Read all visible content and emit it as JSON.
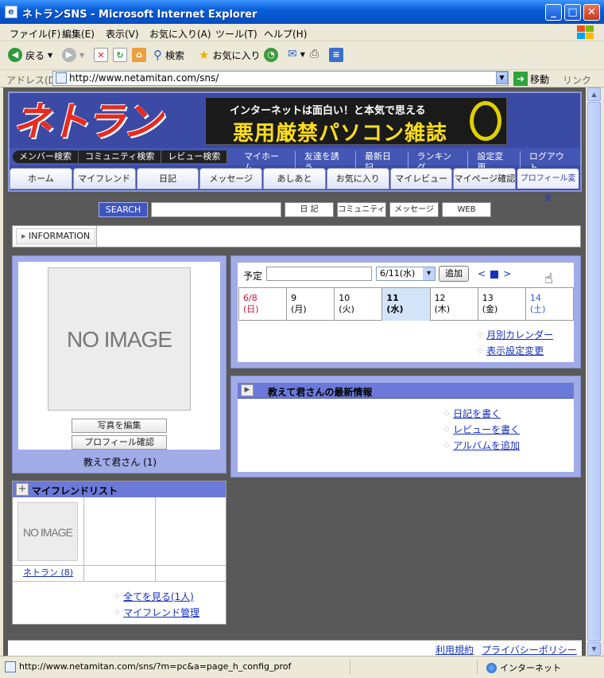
{
  "window": {
    "title": "ネトランSNS - Microsoft Internet Explorer",
    "minimize": "_",
    "maximize": "□",
    "close": "✕"
  },
  "menu": [
    "ファイル(F)",
    "編集(E)",
    "表示(V)",
    "お気に入り(A)",
    "ツール(T)",
    "ヘルプ(H)"
  ],
  "toolbar": {
    "back": "戻る",
    "search": "検索",
    "favorites": "お気に入り"
  },
  "address": {
    "label": "アドレス(D)",
    "url": "http://www.netamitan.com/sns/",
    "go": "移動",
    "links": "リンク"
  },
  "site": {
    "logo": "ネトラン",
    "banner_line1": "インターネットは面白い！と本気で思える",
    "banner_line2": "悪用厳禁パソコン雑誌",
    "nav_left": [
      "メンバー検索",
      "コミュニティ検索",
      "レビュー検索"
    ],
    "nav_right": [
      "マイホーム",
      "友達を誘う",
      "最新日記",
      "ランキング",
      "設定変更",
      "ログアウト"
    ],
    "tabs": [
      "ホーム",
      "マイフレンド",
      "日記",
      "メッセージ",
      "あしあと",
      "お気に入り",
      "マイレビュー",
      "マイページ確認",
      "プロフィール変更"
    ]
  },
  "search": {
    "button": "SEARCH",
    "value": "",
    "options": [
      "日 記",
      "コミュニティ",
      "メッセージ",
      "WEB"
    ]
  },
  "information": {
    "label": "INFORMATION"
  },
  "profile": {
    "image": "NO IMAGE",
    "edit_photo": "写真を編集",
    "check_profile": "プロフィール確認",
    "name": "教えて君さん (1)"
  },
  "calendar": {
    "label": "予定",
    "input_value": "",
    "selected_date": "6/11(水)",
    "add_button": "追加",
    "prev": "<",
    "next": ">",
    "days": [
      {
        "date": "6/8",
        "dow": "(日)"
      },
      {
        "date": "9",
        "dow": "(月)"
      },
      {
        "date": "10",
        "dow": "(火)"
      },
      {
        "date": "11",
        "dow": "(水)"
      },
      {
        "date": "12",
        "dow": "(木)"
      },
      {
        "date": "13",
        "dow": "(金)"
      },
      {
        "date": "14",
        "dow": "(土)"
      }
    ],
    "link_monthly": "月別カレンダー",
    "link_display": "表示設定変更"
  },
  "news": {
    "title": "教えて君さんの最新情報",
    "links": [
      "日記を書く",
      "レビューを書く",
      "アルバムを追加"
    ]
  },
  "friends": {
    "title": "マイフレンドリスト",
    "image": "NO IMAGE",
    "names": [
      "ネトラン (8)",
      "",
      ""
    ],
    "link_all": "全てを見る(1人)",
    "link_manage": "マイフレンド管理"
  },
  "footer": {
    "terms": "利用規約",
    "privacy": "プライバシーポリシー"
  },
  "status": {
    "url": "http://www.netamitan.com/sns/?m=pc&a=page_h_config_prof",
    "zone": "インターネット"
  }
}
